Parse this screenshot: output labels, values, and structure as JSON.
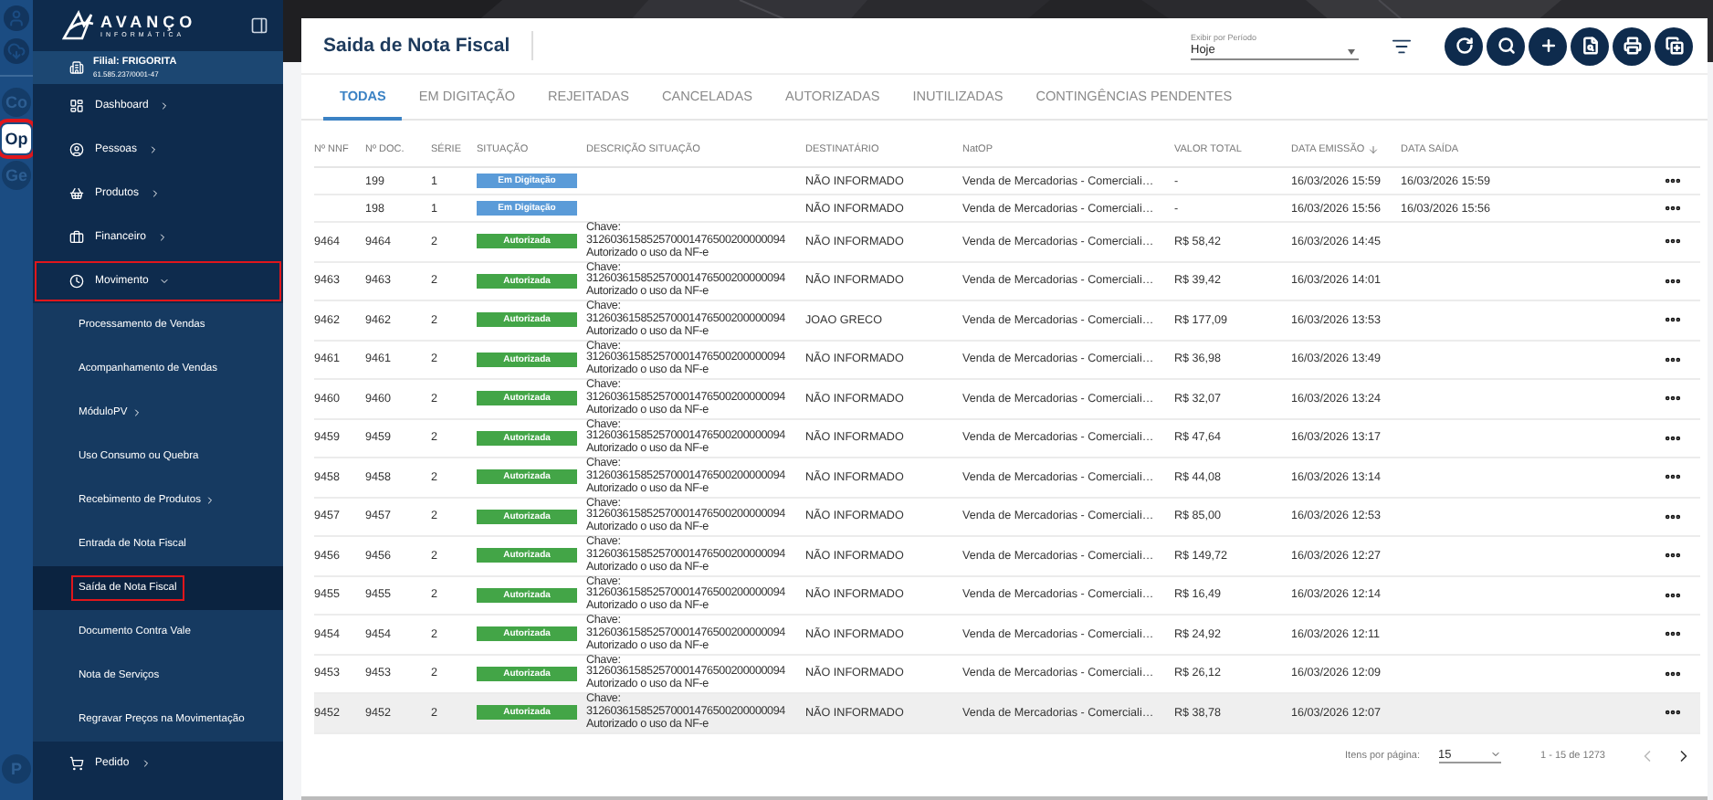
{
  "rail": {
    "top": [
      {
        "kind": "user"
      },
      {
        "kind": "download"
      }
    ],
    "modules": [
      {
        "label": "Co",
        "selected": false,
        "highlighted": false
      },
      {
        "label": "Op",
        "selected": true,
        "highlighted": true
      },
      {
        "label": "Ge",
        "selected": false,
        "highlighted": false
      }
    ],
    "bottom": [
      {
        "label": "P",
        "selected": false,
        "highlighted": false
      }
    ]
  },
  "sidebar": {
    "logo": {
      "name": "AVANÇO",
      "tagline": "INFORMÁTICA"
    },
    "branch": {
      "label": "Filial: FRIGORITA",
      "id": "61.585.237/0001-47"
    },
    "menu": [
      {
        "label": "Dashboard",
        "kind": "dashboard",
        "expandable": true,
        "expanded": false,
        "highlighted": false
      },
      {
        "label": "Pessoas",
        "kind": "people",
        "expandable": true,
        "expanded": false,
        "highlighted": false
      },
      {
        "label": "Produtos",
        "kind": "products",
        "expandable": true,
        "expanded": false,
        "highlighted": false
      },
      {
        "label": "Financeiro",
        "kind": "finance",
        "expandable": true,
        "expanded": false,
        "highlighted": false
      },
      {
        "label": "Movimento",
        "kind": "movement",
        "expandable": true,
        "expanded": true,
        "highlighted": true,
        "children": [
          {
            "label": "Processamento de Vendas",
            "expandable": false,
            "selected": false,
            "highlighted": false
          },
          {
            "label": "Acompanhamento de Vendas",
            "expandable": false,
            "selected": false,
            "highlighted": false
          },
          {
            "label": "MóduloPV",
            "expandable": true,
            "selected": false,
            "highlighted": false
          },
          {
            "label": "Uso Consumo ou Quebra",
            "expandable": false,
            "selected": false,
            "highlighted": false
          },
          {
            "label": "Recebimento de Produtos",
            "expandable": true,
            "selected": false,
            "highlighted": false
          },
          {
            "label": "Entrada de Nota Fiscal",
            "expandable": false,
            "selected": false,
            "highlighted": false
          },
          {
            "label": "Saída de Nota Fiscal",
            "expandable": false,
            "selected": true,
            "highlighted": true
          },
          {
            "label": "Documento Contra Vale",
            "expandable": false,
            "selected": false,
            "highlighted": false
          },
          {
            "label": "Nota de Serviços",
            "expandable": false,
            "selected": false,
            "highlighted": false
          },
          {
            "label": "Regravar Preços na Movimentação",
            "expandable": false,
            "selected": false,
            "highlighted": false
          }
        ]
      },
      {
        "label": "Pedido",
        "kind": "cart",
        "expandable": true,
        "expanded": false,
        "highlighted": false
      }
    ]
  },
  "page": {
    "title": "Saida de Nota Fiscal",
    "period": {
      "label": "Exibir por Período",
      "value": "Hoje"
    },
    "actions": [
      {
        "kind": "refresh"
      },
      {
        "kind": "search"
      },
      {
        "kind": "add"
      },
      {
        "kind": "preview"
      },
      {
        "kind": "print"
      },
      {
        "kind": "duplicate"
      }
    ]
  },
  "tabs": [
    {
      "label": "TODAS",
      "selected": true
    },
    {
      "label": "EM DIGITAÇÃO",
      "selected": false
    },
    {
      "label": "REJEITADAS",
      "selected": false
    },
    {
      "label": "CANCELADAS",
      "selected": false
    },
    {
      "label": "AUTORIZADAS",
      "selected": false
    },
    {
      "label": "INUTILIZADAS",
      "selected": false
    },
    {
      "label": "CONTINGÊNCIAS PENDENTES",
      "selected": false
    }
  ],
  "table": {
    "columns": [
      {
        "label": "Nº NNF"
      },
      {
        "label": "Nº DOC."
      },
      {
        "label": "SÉRIE"
      },
      {
        "label": "SITUAÇÃO"
      },
      {
        "label": "DESCRIÇÃO SITUAÇÃO"
      },
      {
        "label": "DESTINATÁRIO"
      },
      {
        "label": "NatOP"
      },
      {
        "label": "VALOR TOTAL"
      },
      {
        "label": "DATA EMISSÃO",
        "sorted_descending": true
      },
      {
        "label": "DATA SAÍDA"
      }
    ],
    "rows": [
      {
        "doc": "199",
        "serie": "1",
        "status": {
          "label": "Em Digitação",
          "kind": "draft"
        },
        "recipient": "NÃO INFORMADO",
        "natop": "Venda de Mercadorias - Comerciali…",
        "total": "-",
        "issued": "16/03/2026 15:59",
        "shipped": "16/03/2026 15:59",
        "hovered": false
      },
      {
        "doc": "198",
        "serie": "1",
        "status": {
          "label": "Em Digitação",
          "kind": "draft"
        },
        "recipient": "NÃO INFORMADO",
        "natop": "Venda de Mercadorias - Comerciali…",
        "total": "-",
        "issued": "16/03/2026 15:56",
        "shipped": "16/03/2026 15:56",
        "hovered": false
      },
      {
        "nnf": "9464",
        "doc": "9464",
        "serie": "2",
        "status": {
          "label": "Autorizada",
          "kind": "authorized"
        },
        "description": "Chave:\n312603615852570001476500200000094\nAutorizado o uso da NF-e",
        "recipient": "NÃO INFORMADO",
        "natop": "Venda de Mercadorias - Comerciali…",
        "total": "R$ 58,42",
        "issued": "16/03/2026 14:45",
        "hovered": false
      },
      {
        "nnf": "9463",
        "doc": "9463",
        "serie": "2",
        "status": {
          "label": "Autorizada",
          "kind": "authorized"
        },
        "description": "Chave:\n312603615852570001476500200000094\nAutorizado o uso da NF-e",
        "recipient": "NÃO INFORMADO",
        "natop": "Venda de Mercadorias - Comerciali…",
        "total": "R$ 39,42",
        "issued": "16/03/2026 14:01",
        "hovered": false
      },
      {
        "nnf": "9462",
        "doc": "9462",
        "serie": "2",
        "status": {
          "label": "Autorizada",
          "kind": "authorized"
        },
        "description": "Chave:\n312603615852570001476500200000094\nAutorizado o uso da NF-e",
        "recipient": "JOAO GRECO",
        "natop": "Venda de Mercadorias - Comerciali…",
        "total": "R$ 177,09",
        "issued": "16/03/2026 13:53",
        "hovered": false
      },
      {
        "nnf": "9461",
        "doc": "9461",
        "serie": "2",
        "status": {
          "label": "Autorizada",
          "kind": "authorized"
        },
        "description": "Chave:\n312603615852570001476500200000094\nAutorizado o uso da NF-e",
        "recipient": "NÃO INFORMADO",
        "natop": "Venda de Mercadorias - Comerciali…",
        "total": "R$ 36,98",
        "issued": "16/03/2026 13:49",
        "hovered": false
      },
      {
        "nnf": "9460",
        "doc": "9460",
        "serie": "2",
        "status": {
          "label": "Autorizada",
          "kind": "authorized"
        },
        "description": "Chave:\n312603615852570001476500200000094\nAutorizado o uso da NF-e",
        "recipient": "NÃO INFORMADO",
        "natop": "Venda de Mercadorias - Comerciali…",
        "total": "R$ 32,07",
        "issued": "16/03/2026 13:24",
        "hovered": false
      },
      {
        "nnf": "9459",
        "doc": "9459",
        "serie": "2",
        "status": {
          "label": "Autorizada",
          "kind": "authorized"
        },
        "description": "Chave:\n312603615852570001476500200000094\nAutorizado o uso da NF-e",
        "recipient": "NÃO INFORMADO",
        "natop": "Venda de Mercadorias - Comerciali…",
        "total": "R$ 47,64",
        "issued": "16/03/2026 13:17",
        "hovered": false
      },
      {
        "nnf": "9458",
        "doc": "9458",
        "serie": "2",
        "status": {
          "label": "Autorizada",
          "kind": "authorized"
        },
        "description": "Chave:\n312603615852570001476500200000094\nAutorizado o uso da NF-e",
        "recipient": "NÃO INFORMADO",
        "natop": "Venda de Mercadorias - Comerciali…",
        "total": "R$ 44,08",
        "issued": "16/03/2026 13:14",
        "hovered": false
      },
      {
        "nnf": "9457",
        "doc": "9457",
        "serie": "2",
        "status": {
          "label": "Autorizada",
          "kind": "authorized"
        },
        "description": "Chave:\n312603615852570001476500200000094\nAutorizado o uso da NF-e",
        "recipient": "NÃO INFORMADO",
        "natop": "Venda de Mercadorias - Comerciali…",
        "total": "R$ 85,00",
        "issued": "16/03/2026 12:53",
        "hovered": false
      },
      {
        "nnf": "9456",
        "doc": "9456",
        "serie": "2",
        "status": {
          "label": "Autorizada",
          "kind": "authorized"
        },
        "description": "Chave:\n312603615852570001476500200000094\nAutorizado o uso da NF-e",
        "recipient": "NÃO INFORMADO",
        "natop": "Venda de Mercadorias - Comerciali…",
        "total": "R$ 149,72",
        "issued": "16/03/2026 12:27",
        "hovered": false
      },
      {
        "nnf": "9455",
        "doc": "9455",
        "serie": "2",
        "status": {
          "label": "Autorizada",
          "kind": "authorized"
        },
        "description": "Chave:\n312603615852570001476500200000094\nAutorizado o uso da NF-e",
        "recipient": "NÃO INFORMADO",
        "natop": "Venda de Mercadorias - Comerciali…",
        "total": "R$ 16,49",
        "issued": "16/03/2026 12:14",
        "hovered": false
      },
      {
        "nnf": "9454",
        "doc": "9454",
        "serie": "2",
        "status": {
          "label": "Autorizada",
          "kind": "authorized"
        },
        "description": "Chave:\n312603615852570001476500200000094\nAutorizado o uso da NF-e",
        "recipient": "NÃO INFORMADO",
        "natop": "Venda de Mercadorias - Comerciali…",
        "total": "R$ 24,92",
        "issued": "16/03/2026 12:11",
        "hovered": false
      },
      {
        "nnf": "9453",
        "doc": "9453",
        "serie": "2",
        "status": {
          "label": "Autorizada",
          "kind": "authorized"
        },
        "description": "Chave:\n312603615852570001476500200000094\nAutorizado o uso da NF-e",
        "recipient": "NÃO INFORMADO",
        "natop": "Venda de Mercadorias - Comerciali…",
        "total": "R$ 26,12",
        "issued": "16/03/2026 12:09",
        "hovered": false
      },
      {
        "nnf": "9452",
        "doc": "9452",
        "serie": "2",
        "status": {
          "label": "Autorizada",
          "kind": "authorized"
        },
        "description": "Chave:\n312603615852570001476500200000094\nAutorizado o uso da NF-e",
        "recipient": "NÃO INFORMADO",
        "natop": "Venda de Mercadorias - Comerciali…",
        "total": "R$ 38,78",
        "issued": "16/03/2026 12:07",
        "hovered": true
      }
    ]
  },
  "pagination": {
    "label": "Itens por página:",
    "page_size": "15",
    "range": "1 - 15 de 1273",
    "previous_disabled": true,
    "next_disabled": false
  }
}
